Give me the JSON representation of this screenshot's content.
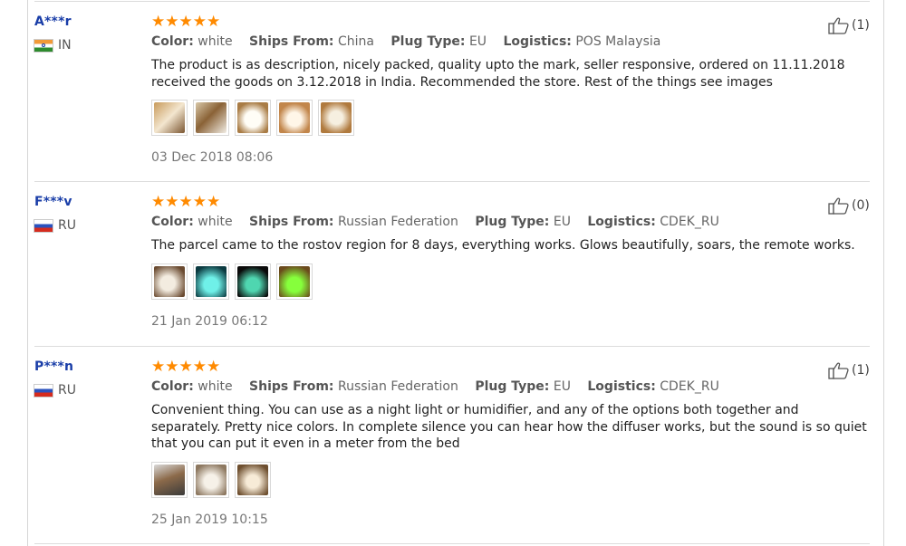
{
  "labels": {
    "color": "Color:",
    "ships_from": "Ships From:",
    "plug_type": "Plug Type:",
    "logistics": "Logistics:"
  },
  "icons": {
    "rating": "star-icon",
    "helpful": "thumbs-up-icon"
  },
  "colors": {
    "star": "#ff8a00",
    "name": "#1a3ea8"
  },
  "reviews": [
    {
      "name": "A***r",
      "country": "IN",
      "rating": 5,
      "color": "white",
      "ships_from": "China",
      "plug_type": "EU",
      "logistics": "POS Malaysia",
      "text": "The product is as description, nicely packed, quality upto the mark, seller responsive, ordered on 11.11.2018 received the goods on 3.12.2018 in India. Recommended the store. Rest of the things see images",
      "photos": [
        "review-photo-1",
        "review-photo-2",
        "review-photo-3",
        "review-photo-4",
        "review-photo-5"
      ],
      "date": "03 Dec 2018 08:06",
      "helpful": "(1)"
    },
    {
      "name": "F***v",
      "country": "RU",
      "rating": 5,
      "color": "white",
      "ships_from": "Russian Federation",
      "plug_type": "EU",
      "logistics": "CDEK_RU",
      "text": "The parcel came to the rostov region for 8 days, everything works. Glows beautifully, soars, the remote works.",
      "photos": [
        "review-photo-1",
        "review-photo-2",
        "review-photo-3",
        "review-photo-4"
      ],
      "date": "21 Jan 2019 06:12",
      "helpful": "(0)"
    },
    {
      "name": "P***n",
      "country": "RU",
      "rating": 5,
      "color": "white",
      "ships_from": "Russian Federation",
      "plug_type": "EU",
      "logistics": "CDEK_RU",
      "text": "Convenient thing. You can use as a night light or humidifier, and any of the options both together and separately. Pretty nice colors. In complete silence you can hear how the diffuser works, but the sound is so quiet that you can put it even in a meter from the bed",
      "photos": [
        "review-photo-1",
        "review-photo-2",
        "review-photo-3"
      ],
      "date": "25 Jan 2019 10:15",
      "helpful": "(1)"
    }
  ]
}
